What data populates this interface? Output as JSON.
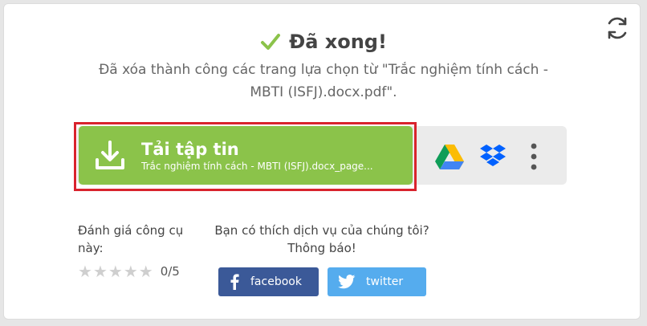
{
  "result": {
    "title": "Đã xong!",
    "message": "Đã xóa thành công các trang lựa chọn từ \"Trắc nghiệm tính cách - MBTI (ISFJ).docx.pdf\"."
  },
  "download": {
    "label": "Tải tập tin",
    "filename": "Trắc nghiệm tính cách - MBTI (ISFJ).docx_page..."
  },
  "rating": {
    "label": "Đánh giá công cụ này:",
    "value": "0/5",
    "stars_filled": 0,
    "stars_total": 5
  },
  "share": {
    "question": "Bạn có thích dịch vụ của chúng tôi?",
    "prompt": "Thông báo!",
    "facebook_label": "facebook",
    "twitter_label": "twitter"
  },
  "colors": {
    "success_check": "#8bc34a",
    "download_bg": "#8bc34a",
    "highlight_border": "#d9232d",
    "facebook": "#3b5998",
    "twitter": "#55acee"
  },
  "icons": [
    "refresh-icon",
    "check-icon",
    "download-icon",
    "google-drive-icon",
    "dropbox-icon",
    "more-options-icon",
    "star-icon",
    "facebook-icon",
    "twitter-icon"
  ]
}
